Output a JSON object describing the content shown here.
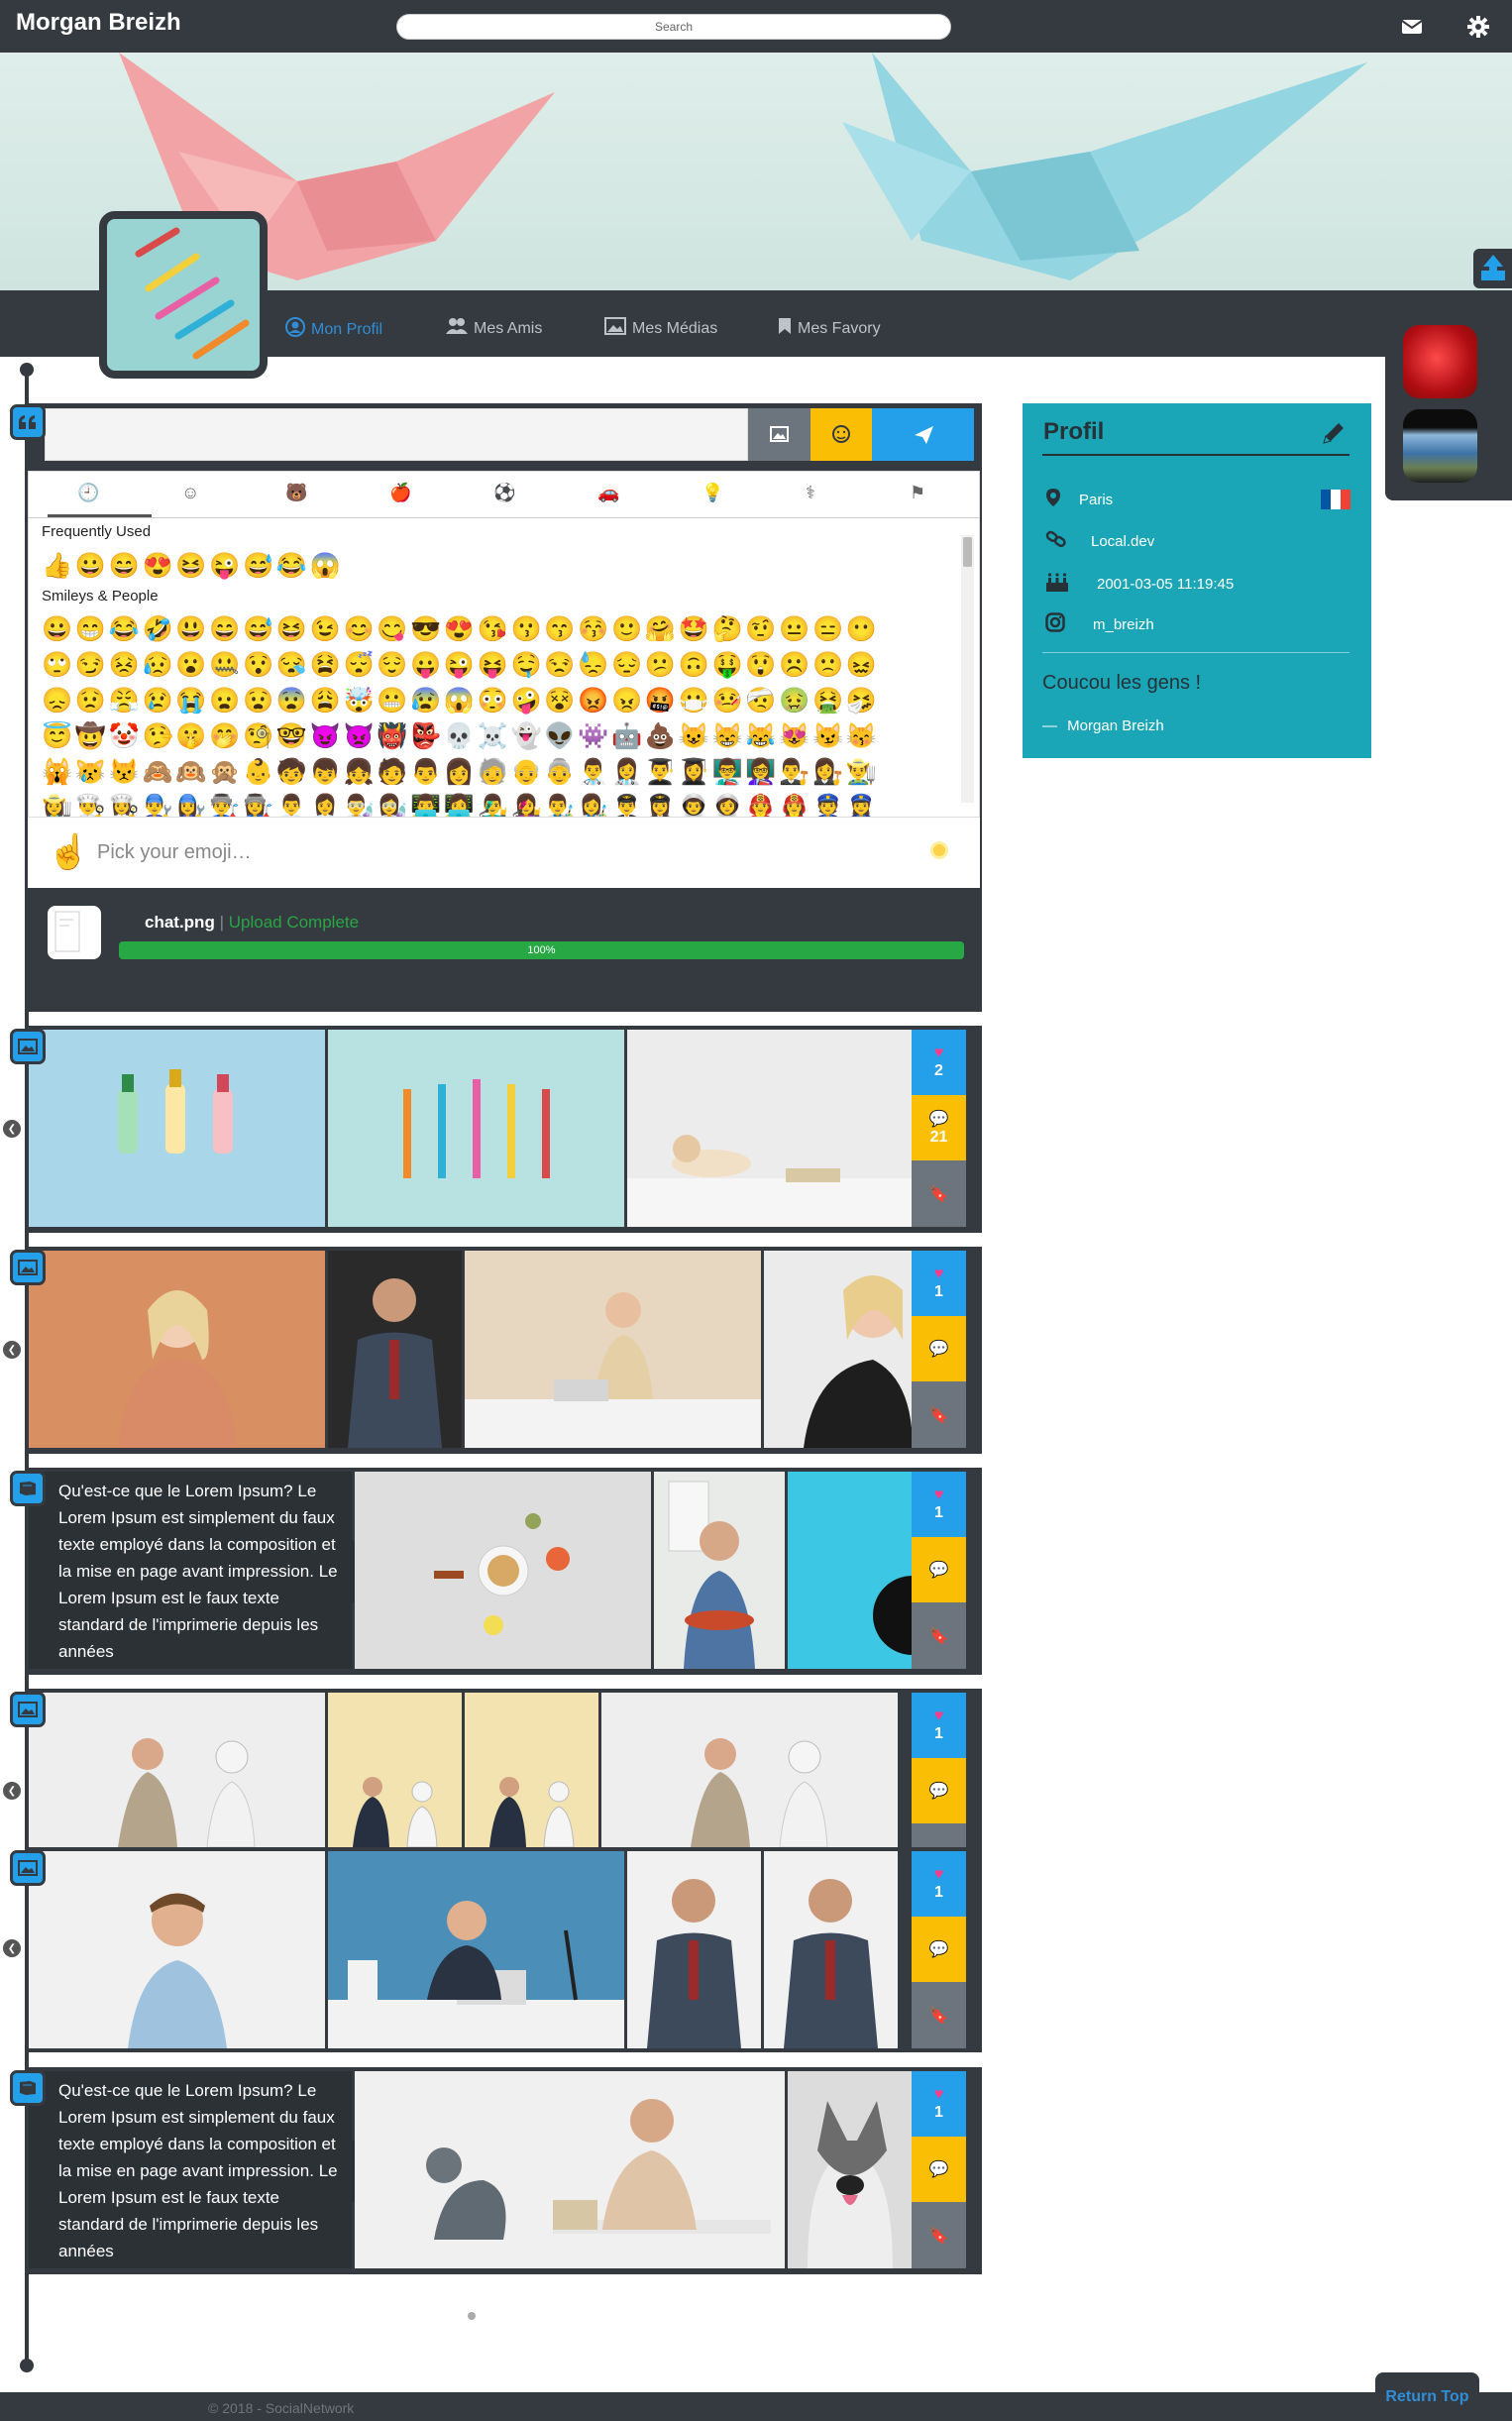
{
  "header": {
    "brand": "Morgan Breizh",
    "search_placeholder": "Search",
    "icons": [
      "envelope-icon",
      "gear-icon"
    ]
  },
  "nav": {
    "tabs": [
      {
        "label": "Mon Profil",
        "icon": "user-circle-icon",
        "active": true
      },
      {
        "label": "Mes Amis",
        "icon": "users-icon",
        "active": false
      },
      {
        "label": "Mes Médias",
        "icon": "image-icon",
        "active": false
      },
      {
        "label": "Mes Favory",
        "icon": "bookmark-icon",
        "active": false
      }
    ]
  },
  "composer": {
    "emoji_tabs": [
      "clock-icon",
      "smiley-icon",
      "animal-icon",
      "food-icon",
      "sport-icon",
      "car-icon",
      "bulb-icon",
      "symbols-icon",
      "flag-icon"
    ],
    "sections": [
      {
        "title": "Frequently Used",
        "rows": [
          "👍😀😄😍😆😜😅😂😱"
        ]
      },
      {
        "title": "Smileys & People",
        "rows": [
          "😀😁😂🤣😃😄😅😆😉😊😋😎😍😘😗😙😚🙂🤗🤩🤔🤨😐😑😶",
          "🙄😏😣😥😮🤐😯😪😫😴😌😛😜😝🤤😒😓😔😕🙃🤑😲☹️🙁😖",
          "😞😟😤😢😭😦😧😨😩🤯😬😰😱😳🤪😵😡😠🤬😷🤒🤕🤢🤮🤧",
          "😇🤠🤡🤥🤫🤭🧐🤓😈👿👹👺💀☠️👻👽👾🤖💩😺😸😹😻😼😽",
          "🙀😿😾🙈🙉🙊👶🧒👦👧🧑👨👩🧓👴👵👨‍⚕️👩‍⚕️👨‍🎓👩‍🎓👨‍🏫👩‍🏫👨‍⚖️👩‍⚖️👨‍🌾",
          "👩‍🌾👨‍🍳👩‍🍳👨‍🔧👩‍🔧👨‍🏭👩‍🏭👨‍💼👩‍💼👨‍🔬👩‍🔬👨‍💻👩‍💻👨‍🎤👩‍🎤👨‍🎨👩‍🎨👨‍✈️👩‍✈️👨‍🚀👩‍🚀👨‍🚒👩‍🚒👮👮‍♀️"
        ]
      }
    ],
    "pick_placeholder": "Pick your emoji…",
    "upload": {
      "filename": "chat.png",
      "status": "Upload Complete",
      "separator": "|",
      "progress_label": "100%",
      "progress": 100
    }
  },
  "posts": [
    {
      "type": "images",
      "likes": "2",
      "comments": "21"
    },
    {
      "type": "images",
      "likes": "1",
      "comments": ""
    },
    {
      "type": "text",
      "likes": "1",
      "comments": "",
      "text": "Qu'est-ce que le Lorem Ipsum? Le Lorem Ipsum est simplement du faux texte employé dans la composition et la mise en page avant impression. Le Lorem Ipsum est le faux texte standard de l'imprimerie depuis les années"
    },
    {
      "type": "images",
      "likes": "1",
      "comments": ""
    },
    {
      "type": "images",
      "likes": "1",
      "comments": ""
    },
    {
      "type": "text",
      "likes": "1",
      "comments": "",
      "text": "Qu'est-ce que le Lorem Ipsum? Le Lorem Ipsum est simplement du faux texte employé dans la composition et la mise en page avant impression. Le Lorem Ipsum est le faux texte standard de l'imprimerie depuis les années"
    }
  ],
  "profile": {
    "title": "Profil",
    "city": "Paris",
    "website": "Local.dev",
    "birthdate": "2001-03-05 11:19:45",
    "instagram": "m_breizh",
    "quote": "Coucou les gens !",
    "author": "Morgan Breizh",
    "author_dash": "—",
    "accent": "#1aa6b7"
  },
  "footer": {
    "copyright": "© 2018 - SocialNetwork",
    "return_top": "Return Top"
  },
  "colors": {
    "dark": "#353a40",
    "blue": "#249fe9",
    "yellow": "#fabe05",
    "grey": "#6c757d",
    "green": "#28a745"
  }
}
